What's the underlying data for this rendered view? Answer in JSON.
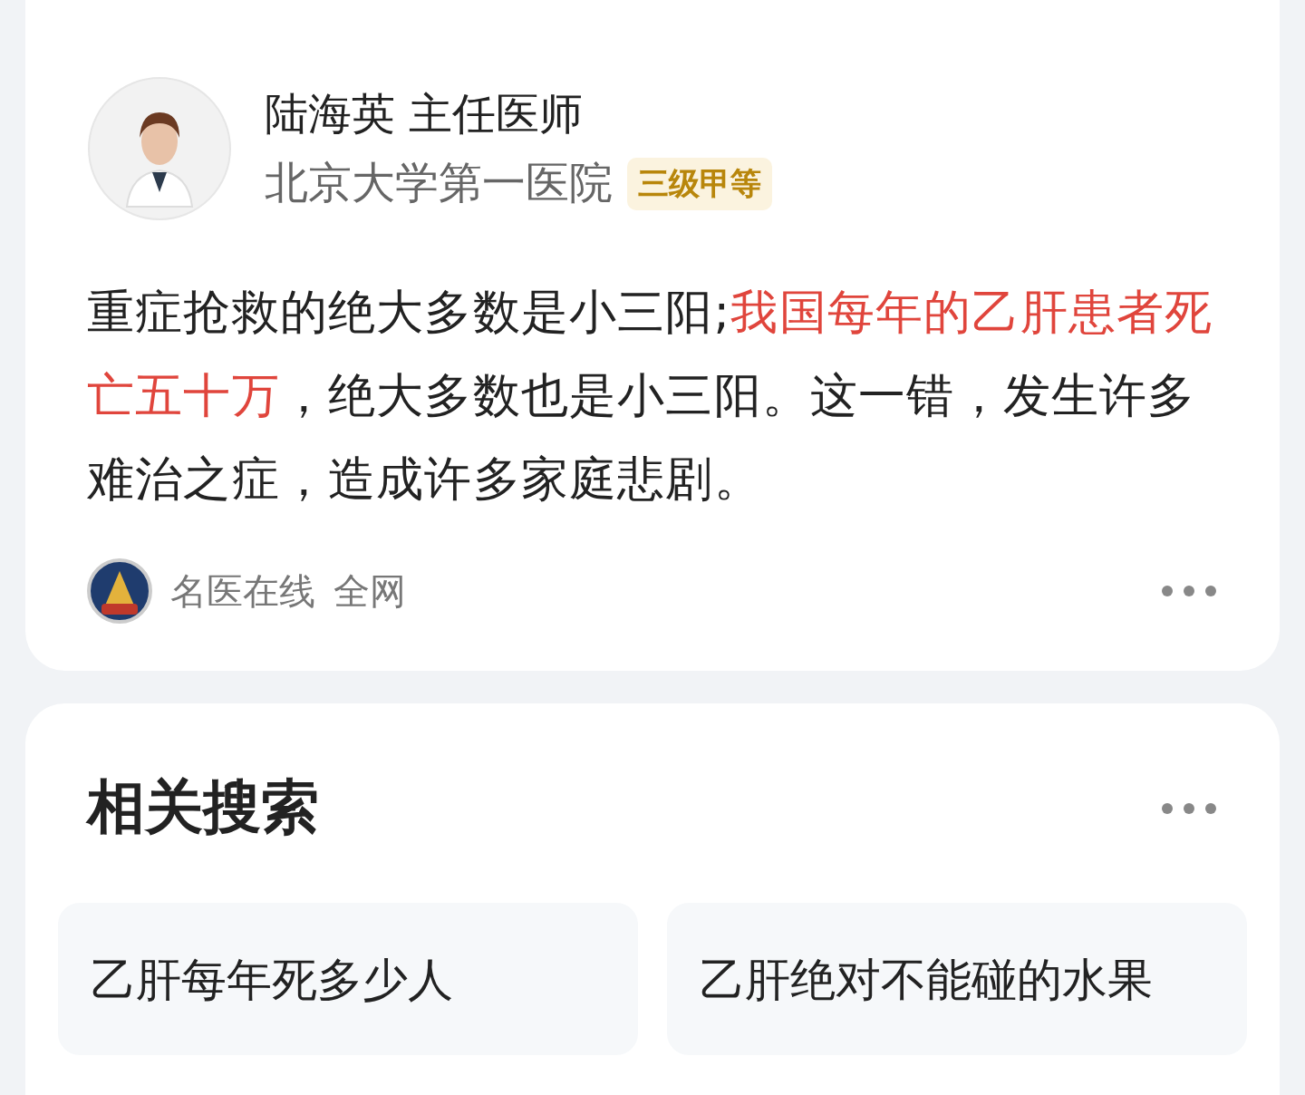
{
  "result_card": {
    "author": {
      "name": "陆海英 主任医师",
      "hospital": "北京大学第一医院",
      "badge": "三级甲等"
    },
    "body": [
      {
        "text": "重症抢救的绝大多数是小三阳;",
        "highlight": false
      },
      {
        "text": "我国每年的乙肝患者死亡五十万",
        "highlight": true
      },
      {
        "text": "，绝大多数也是小三阳。这一错，发生许多难治之症，造成许多家庭悲剧。",
        "highlight": false
      }
    ],
    "source": {
      "name": "名医在线",
      "scope": "全网"
    }
  },
  "related_search": {
    "title": "相关搜索",
    "items": [
      "乙肝每年死多少人",
      "乙肝绝对不能碰的水果"
    ]
  }
}
